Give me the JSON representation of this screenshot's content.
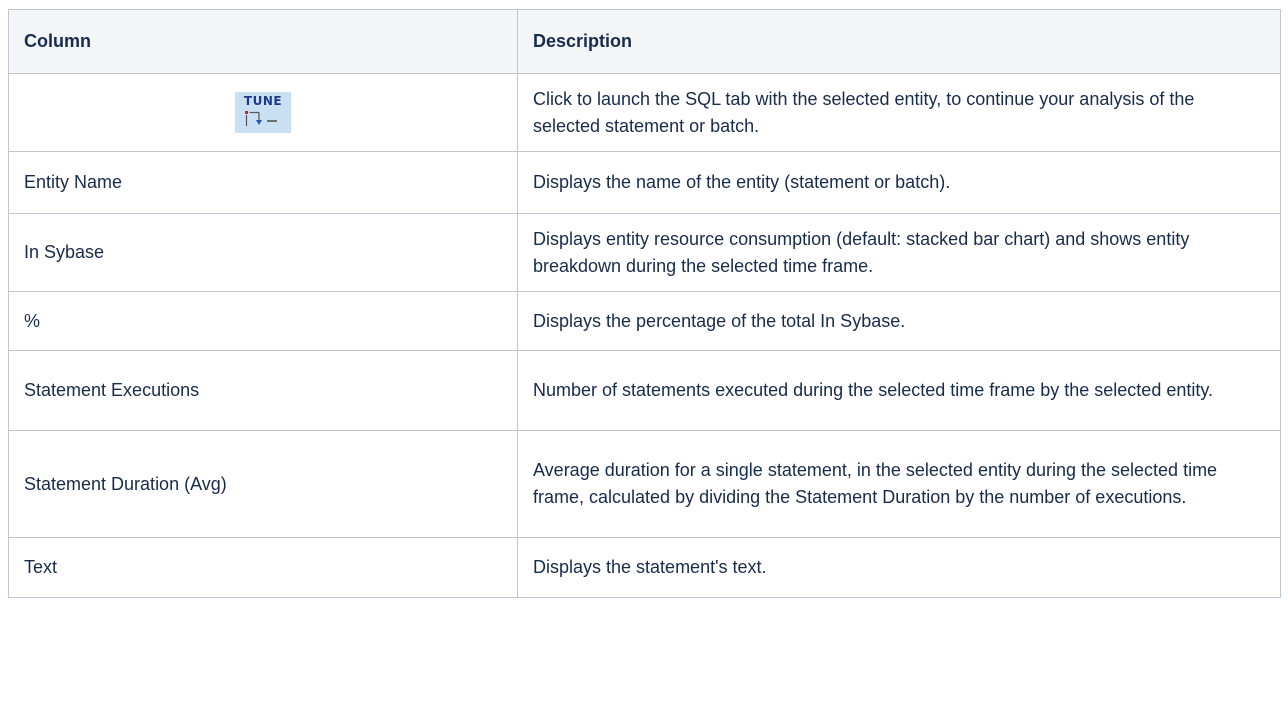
{
  "table": {
    "headers": {
      "column": "Column",
      "description": "Description"
    },
    "rows": [
      {
        "column": "",
        "icon": "tune-icon",
        "icon_label": "TUNE",
        "description": "Click to launch the SQL tab with the selected entity, to continue your analysis of the selected statement or batch."
      },
      {
        "column": "Entity Name",
        "description": "Displays the name of the entity (statement or batch)."
      },
      {
        "column": "In Sybase",
        "description": "Displays entity resource consumption (default: stacked bar chart) and shows entity breakdown during the selected time frame."
      },
      {
        "column": "%",
        "description": "Displays the percentage of the total In Sybase."
      },
      {
        "column": "Statement Executions",
        "description": "Number of statements executed during the selected time frame by the selected entity."
      },
      {
        "column": "Statement Duration (Avg)",
        "description": "Average duration for a single statement, in the selected entity during the selected time frame, calculated by dividing the Statement Duration by the number of executions."
      },
      {
        "column": "Text",
        "description": "Displays the statement's text."
      }
    ]
  }
}
